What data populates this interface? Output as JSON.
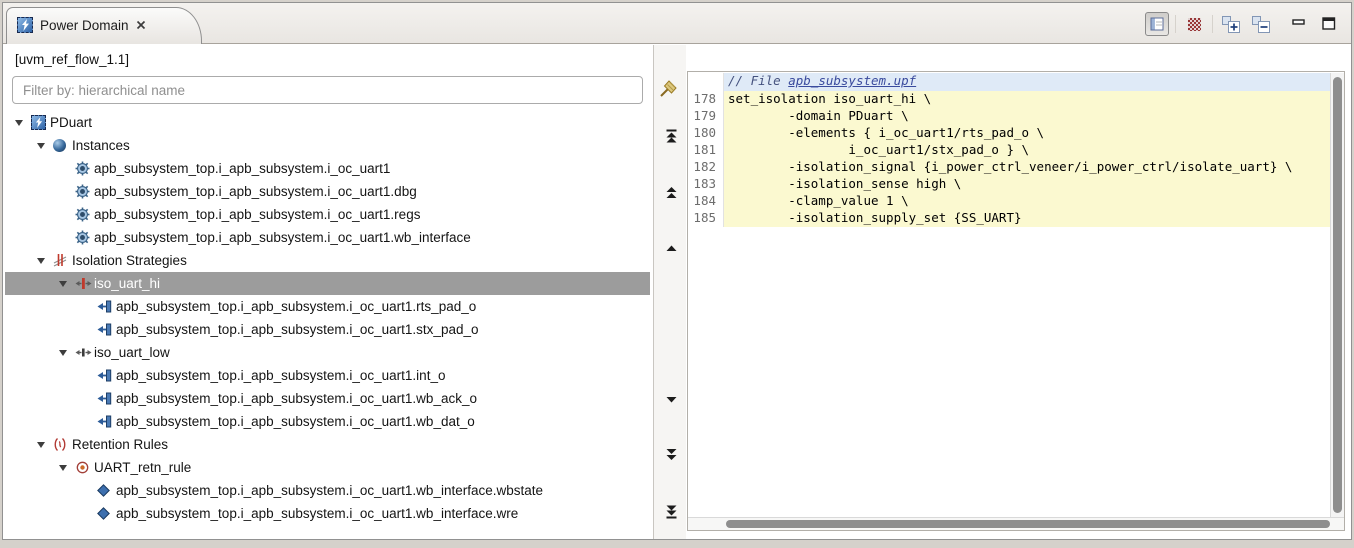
{
  "tab": {
    "title": "Power Domain"
  },
  "toolbar": {
    "buttons": [
      "linked-view-toggle",
      "pattern-filter",
      "expand-all",
      "collapse-all",
      "minimize",
      "maximize"
    ]
  },
  "breadcrumb": "[uvm_ref_flow_1.1]",
  "filter": {
    "placeholder": "Filter by: hierarchical name",
    "value": ""
  },
  "tree": {
    "items": [
      {
        "label": "PDuart",
        "icon": "power-domain-chip-icon",
        "level": 0,
        "expanded": true
      },
      {
        "label": "Instances",
        "icon": "instances-icon",
        "level": 1,
        "expanded": true
      },
      {
        "label": "apb_subsystem_top.i_apb_subsystem.i_oc_uart1",
        "icon": "module-icon",
        "level": 2
      },
      {
        "label": "apb_subsystem_top.i_apb_subsystem.i_oc_uart1.dbg",
        "icon": "module-icon",
        "level": 2
      },
      {
        "label": "apb_subsystem_top.i_apb_subsystem.i_oc_uart1.regs",
        "icon": "module-icon",
        "level": 2
      },
      {
        "label": "apb_subsystem_top.i_apb_subsystem.i_oc_uart1.wb_interface",
        "icon": "module-icon",
        "level": 2
      },
      {
        "label": "Isolation Strategies",
        "icon": "isolation-strategies-icon",
        "level": 1,
        "expanded": true
      },
      {
        "label": "iso_uart_hi",
        "icon": "isolation-strategy-hi-icon",
        "level": 2,
        "expanded": true,
        "selected": true
      },
      {
        "label": "apb_subsystem_top.i_apb_subsystem.i_oc_uart1.rts_pad_o",
        "icon": "port-icon",
        "level": 3
      },
      {
        "label": "apb_subsystem_top.i_apb_subsystem.i_oc_uart1.stx_pad_o",
        "icon": "port-icon",
        "level": 3
      },
      {
        "label": "iso_uart_low",
        "icon": "isolation-strategy-low-icon",
        "level": 2,
        "expanded": true
      },
      {
        "label": "apb_subsystem_top.i_apb_subsystem.i_oc_uart1.int_o",
        "icon": "port-icon",
        "level": 3
      },
      {
        "label": "apb_subsystem_top.i_apb_subsystem.i_oc_uart1.wb_ack_o",
        "icon": "port-icon",
        "level": 3
      },
      {
        "label": "apb_subsystem_top.i_apb_subsystem.i_oc_uart1.wb_dat_o",
        "icon": "port-icon",
        "level": 3
      },
      {
        "label": "Retention Rules",
        "icon": "retention-rules-icon",
        "level": 1,
        "expanded": true
      },
      {
        "label": "UART_retn_rule",
        "icon": "retention-rule-icon",
        "level": 2,
        "expanded": true
      },
      {
        "label": "apb_subsystem_top.i_apb_subsystem.i_oc_uart1.wb_interface.wbstate",
        "icon": "state-diamond-icon",
        "level": 3
      },
      {
        "label": "apb_subsystem_top.i_apb_subsystem.i_oc_uart1.wb_interface.wre",
        "icon": "state-diamond-icon",
        "level": 3
      }
    ]
  },
  "nav": {
    "buttons": [
      "scroll-to-top",
      "page-up",
      "scroll-up",
      "scroll-down",
      "page-down",
      "scroll-to-bottom"
    ]
  },
  "editor": {
    "header": {
      "comment_prefix": "// File ",
      "file_link": "apb_subsystem.upf"
    },
    "lines": [
      {
        "number": "178",
        "text": "set_isolation iso_uart_hi \\"
      },
      {
        "number": "179",
        "text": "        -domain PDuart \\"
      },
      {
        "number": "180",
        "text": "        -elements { i_oc_uart1/rts_pad_o \\"
      },
      {
        "number": "181",
        "text": "                i_oc_uart1/stx_pad_o } \\"
      },
      {
        "number": "182",
        "text": "        -isolation_signal {i_power_ctrl_veneer/i_power_ctrl/isolate_uart} \\"
      },
      {
        "number": "183",
        "text": "        -isolation_sense high \\"
      },
      {
        "number": "184",
        "text": "        -clamp_value 1 \\"
      },
      {
        "number": "185",
        "text": "        -isolation_supply_set {SS_UART}"
      }
    ]
  },
  "colors": {
    "selection": "#9c9c9c",
    "code_highlight": "#fbf9d0",
    "header_highlight": "#dfeaf7",
    "link": "#3a4b9e",
    "icon_blue": "#3d6fae",
    "icon_red": "#c0392b"
  }
}
